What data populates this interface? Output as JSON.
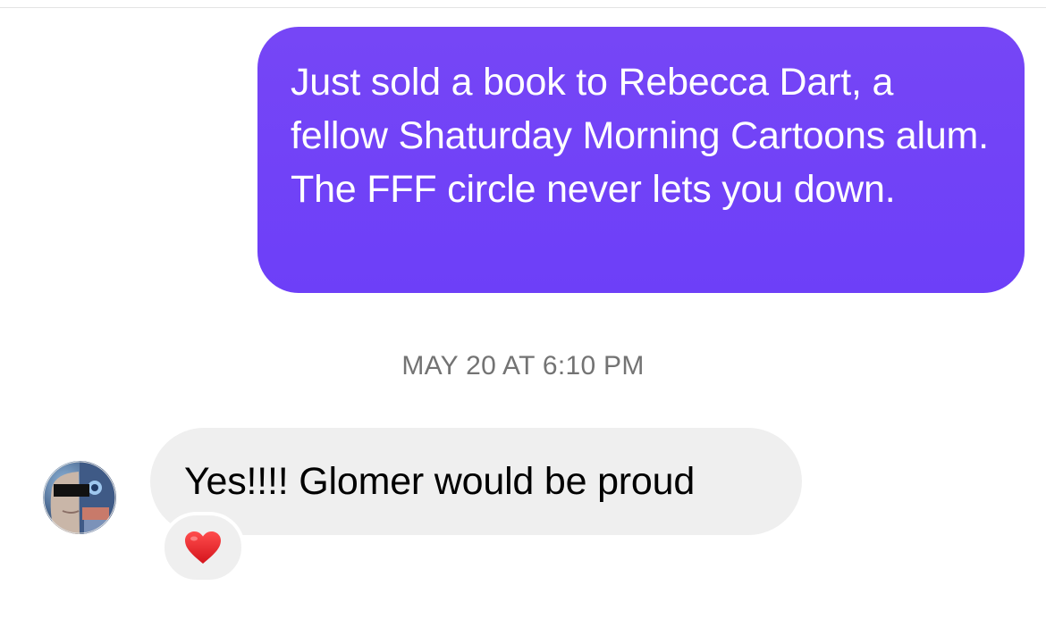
{
  "thread": {
    "outgoing_message": {
      "text": "Just sold a book to Rebecca Dart, a fellow Shaturday Morning Cartoons alum. The FFF circle never lets you down.",
      "bubble_color": "#7245F7",
      "text_color": "#FFFFFF"
    },
    "timestamp": "MAY 20 AT 6:10 PM",
    "incoming_message": {
      "text": "Yes!!!! Glomer would be proud",
      "bubble_color": "#EFEFEF",
      "avatar_icon": "user-avatar-icon",
      "reaction_icon": "red-heart-icon",
      "reaction_color": "#E5242A"
    }
  }
}
